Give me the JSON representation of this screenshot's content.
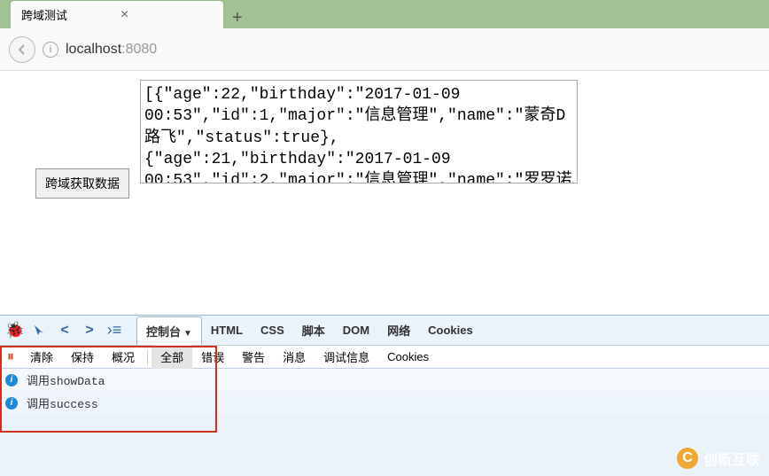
{
  "browser": {
    "tab_title": "跨域测试",
    "url_host": "localhost",
    "url_port": ":8080"
  },
  "page": {
    "fetch_button_label": "跨域获取数据",
    "textarea_content": "[{\"age\":22,\"birthday\":\"2017-01-09 00:53\",\"id\":1,\"major\":\"信息管理\",\"name\":\"蒙奇D路飞\",\"status\":true},\n{\"age\":21,\"birthday\":\"2017-01-09 00:53\",\"id\":2,\"major\":\"信息管理\",\"name\":\"罗罗诺"
  },
  "devtools": {
    "main_tabs": {
      "console": "控制台",
      "html": "HTML",
      "css": "CSS",
      "script": "脚本",
      "dom": "DOM",
      "network": "网络",
      "cookies": "Cookies"
    },
    "sub_tabs": {
      "clear": "清除",
      "persist": "保持",
      "profile": "概况",
      "all": "全部",
      "errors": "错误",
      "warnings": "警告",
      "info": "消息",
      "debug": "调试信息",
      "cookies": "Cookies"
    },
    "console_lines": [
      {
        "prefix": "调用",
        "code": "showData"
      },
      {
        "prefix": "调用",
        "code": "success"
      }
    ]
  },
  "watermark": {
    "text": "创新互联",
    "icon_letter": "C"
  }
}
